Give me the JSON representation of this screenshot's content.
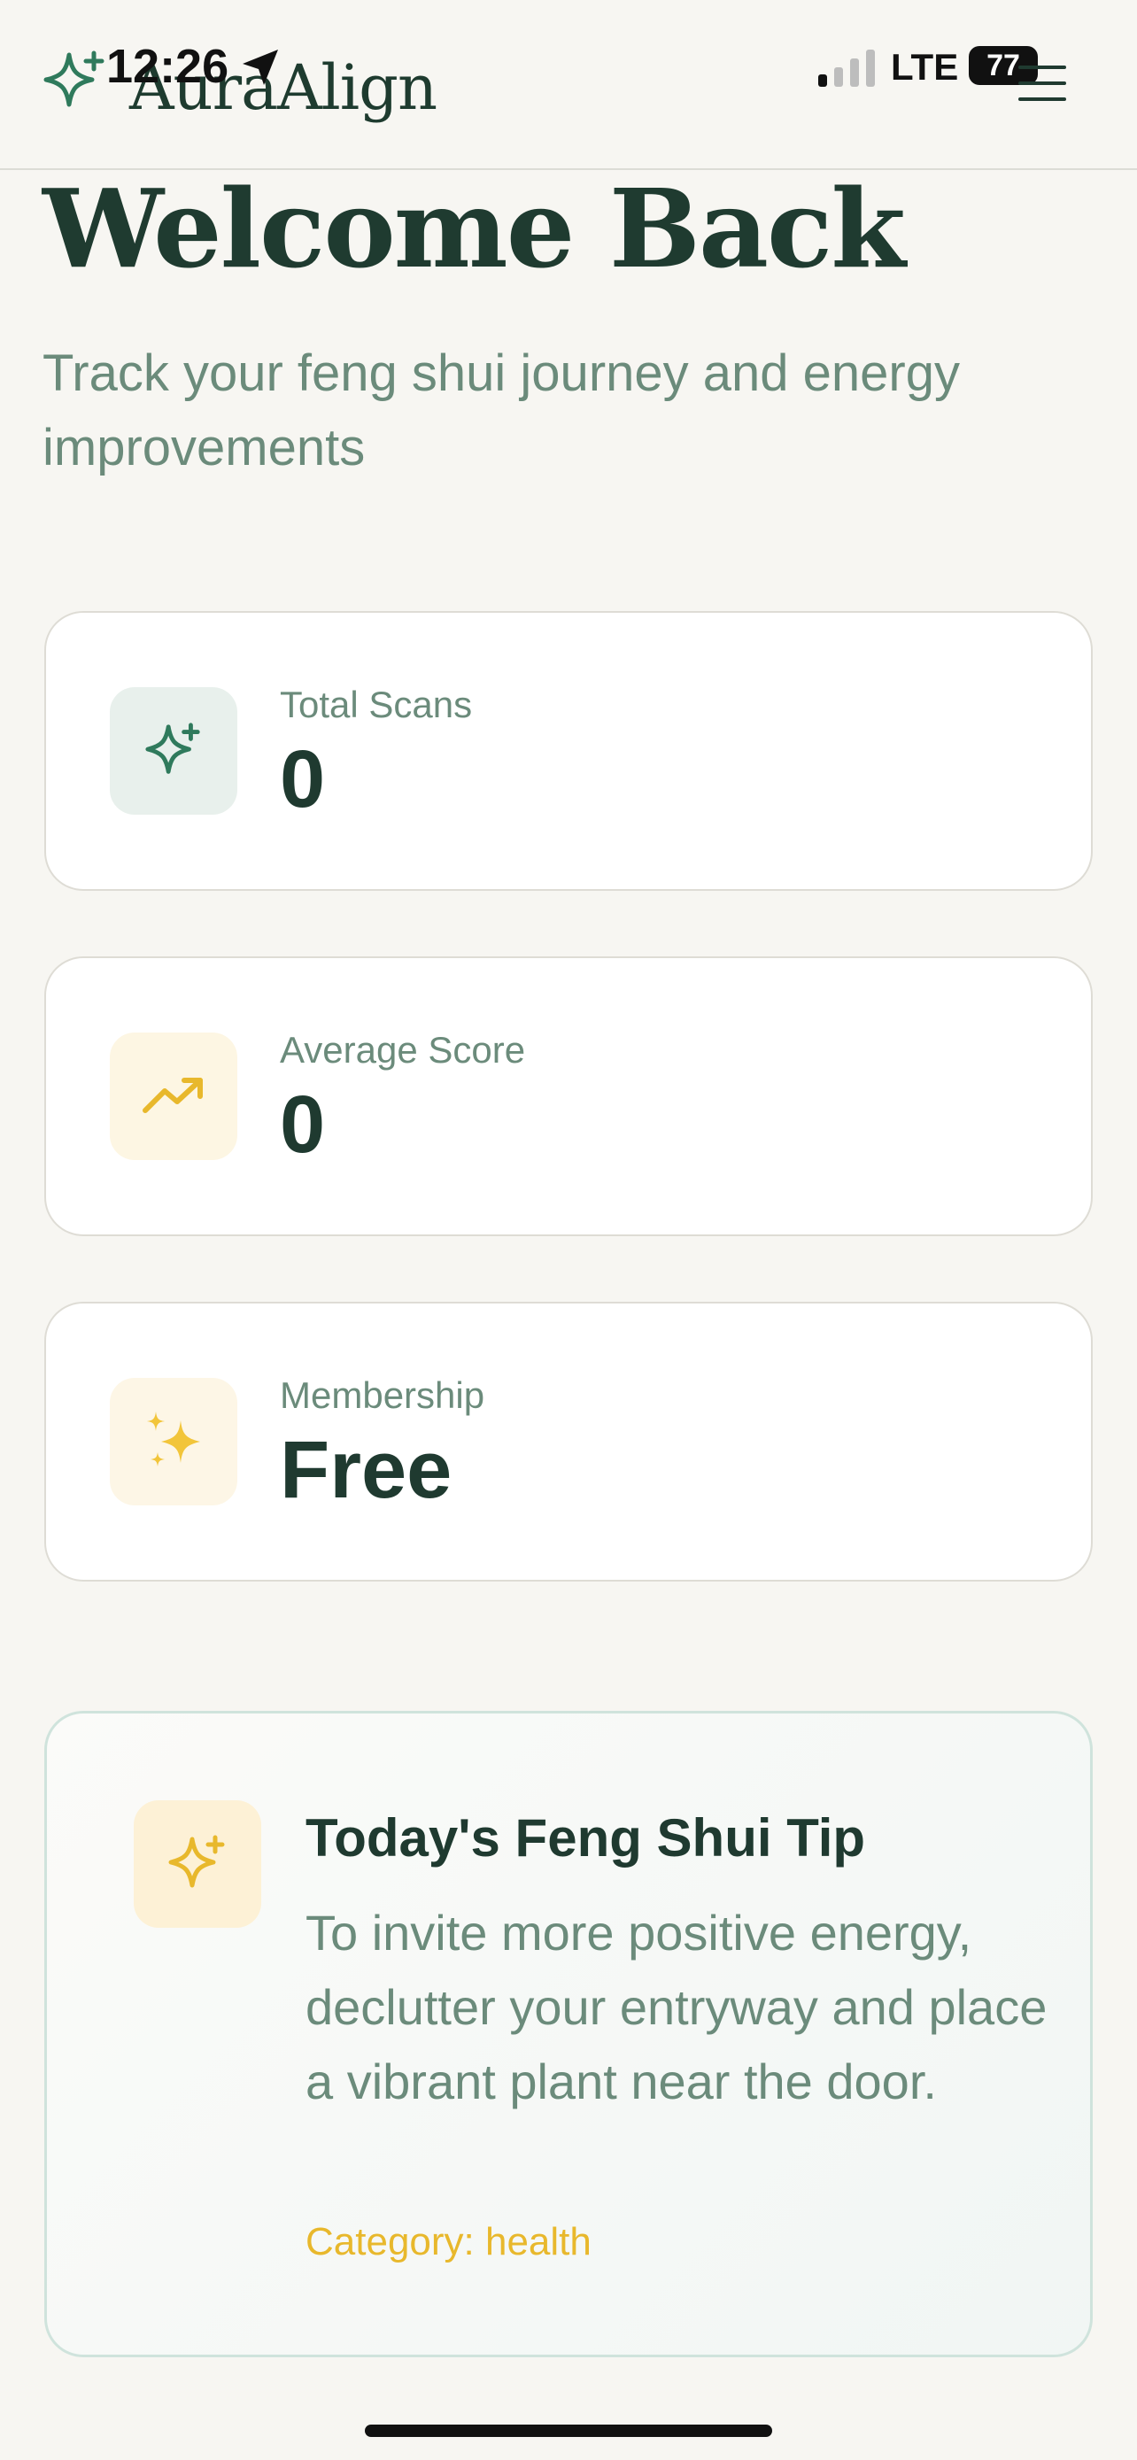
{
  "status_bar": {
    "time": "12:26",
    "network": "LTE",
    "battery": "77"
  },
  "header": {
    "app_name": "AuraAlign",
    "logo_icon": "sparkle-icon",
    "menu_icon": "hamburger-menu-icon"
  },
  "hero": {
    "title": "Welcome Back",
    "subtitle": "Track your feng shui journey and energy improvements"
  },
  "stats": [
    {
      "label": "Total Scans",
      "value": "0",
      "icon": "sparkle-icon",
      "icon_bg": "#e8f0ec",
      "icon_color": "#2f7a5c"
    },
    {
      "label": "Average Score",
      "value": "0",
      "icon": "trending-up-icon",
      "icon_bg": "#fdf6e3",
      "icon_color": "#e8b82c"
    },
    {
      "label": "Membership",
      "value": "Free",
      "icon": "sparkles-emoji-icon",
      "icon_bg": "#fdf6e6",
      "icon_color": "#f2c53a"
    }
  ],
  "tip": {
    "title": "Today's Feng Shui Tip",
    "body": "To invite more positive energy, declutter your entryway and place a vibrant plant near the door.",
    "category": "Category: health",
    "icon": "sparkle-icon"
  },
  "colors": {
    "background": "#f7f6f2",
    "primary_dark": "#1f3a30",
    "muted_green": "#6b8b7b",
    "accent_gold": "#e8b82c",
    "brand_green": "#2f7a5c"
  }
}
